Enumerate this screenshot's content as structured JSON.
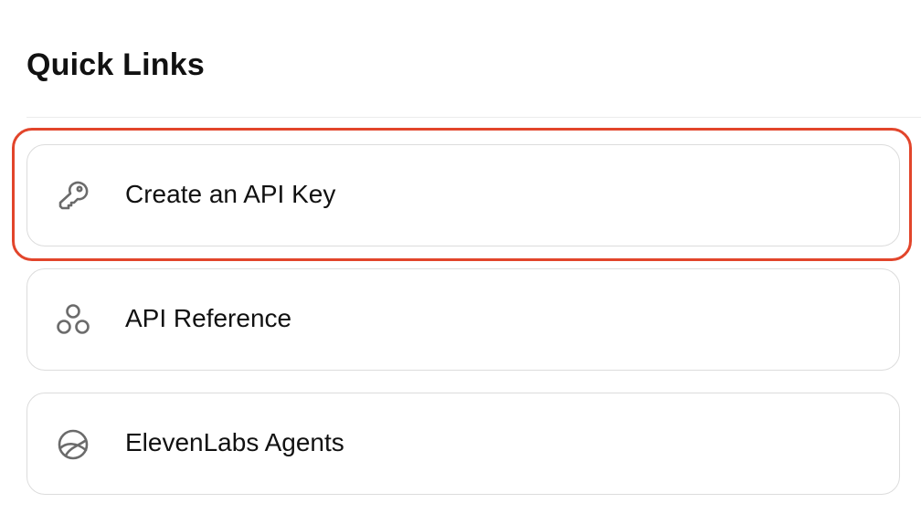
{
  "section": {
    "title": "Quick Links"
  },
  "links": [
    {
      "label": "Create an API Key",
      "icon": "key-icon"
    },
    {
      "label": "API Reference",
      "icon": "three-circles-icon"
    },
    {
      "label": "ElevenLabs Agents",
      "icon": "globe-icon"
    }
  ],
  "colors": {
    "highlight": "#e2452b",
    "card_border": "#dcdcdc",
    "icon": "#6b6b6b",
    "text": "#111111"
  }
}
